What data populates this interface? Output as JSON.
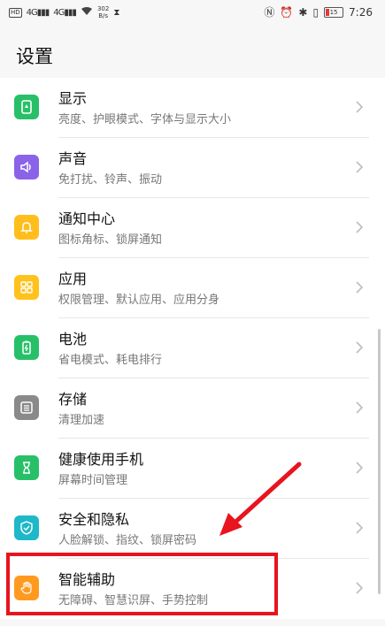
{
  "status_bar": {
    "hd": "HD",
    "net1": "4G",
    "net2": "4G",
    "speed_value": "302",
    "speed_unit": "B/s",
    "time": "7:26",
    "battery": "15"
  },
  "page": {
    "title": "设置"
  },
  "items": [
    {
      "title": "显示",
      "subtitle": "亮度、护眼模式、字体与显示大小",
      "icon": "display-icon",
      "color": "#27c069"
    },
    {
      "title": "声音",
      "subtitle": "免打扰、铃声、振动",
      "icon": "sound-icon",
      "color": "#8b63e8"
    },
    {
      "title": "通知中心",
      "subtitle": "图标角标、锁屏通知",
      "icon": "notification-bell-icon",
      "color": "#ffbe1c"
    },
    {
      "title": "应用",
      "subtitle": "权限管理、默认应用、应用分身",
      "icon": "apps-grid-icon",
      "color": "#ffc21c"
    },
    {
      "title": "电池",
      "subtitle": "省电模式、耗电排行",
      "icon": "battery-icon",
      "color": "#27c069"
    },
    {
      "title": "存储",
      "subtitle": "清理加速",
      "icon": "storage-icon",
      "color": "#8a8a8a"
    },
    {
      "title": "健康使用手机",
      "subtitle": "屏幕时间管理",
      "icon": "hourglass-icon",
      "color": "#27c069"
    },
    {
      "title": "安全和隐私",
      "subtitle": "人脸解锁、指纹、锁屏密码",
      "icon": "shield-check-icon",
      "color": "#1fb8c8"
    },
    {
      "title": "智能辅助",
      "subtitle": "无障碍、智慧识屏、手势控制",
      "icon": "hand-icon",
      "color": "#ff9a1f"
    }
  ],
  "annotation": {
    "highlight_color": "#e8141e"
  }
}
